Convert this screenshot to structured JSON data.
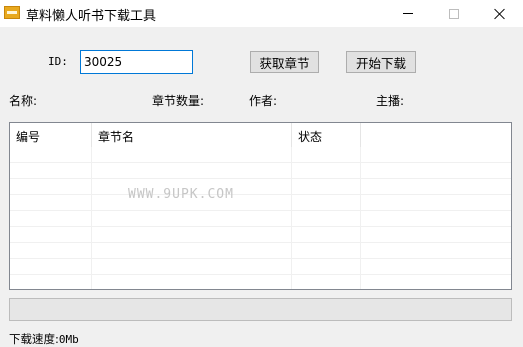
{
  "window": {
    "title": "草料懒人听书下载工具",
    "icon": "app-logo-icon"
  },
  "form": {
    "id_label": "ID:",
    "id_value": "30025",
    "fetch_button": "获取章节",
    "download_button": "开始下载"
  },
  "info": {
    "name_label": "名称:",
    "chapter_count_label": "章节数量:",
    "author_label": "作者:",
    "narrator_label": "主播:"
  },
  "list": {
    "columns": [
      "编号",
      "章节名",
      "状态"
    ],
    "rows": []
  },
  "watermark": "WWW.9UPK.COM",
  "progress": {
    "fraction": 0.0
  },
  "status": {
    "speed_label": "下载速度:",
    "speed_value": "0Mb"
  },
  "colors": {
    "accent": "#0078d7",
    "button_bg": "#e1e1e1",
    "window_bg": "#f0f0f0"
  }
}
